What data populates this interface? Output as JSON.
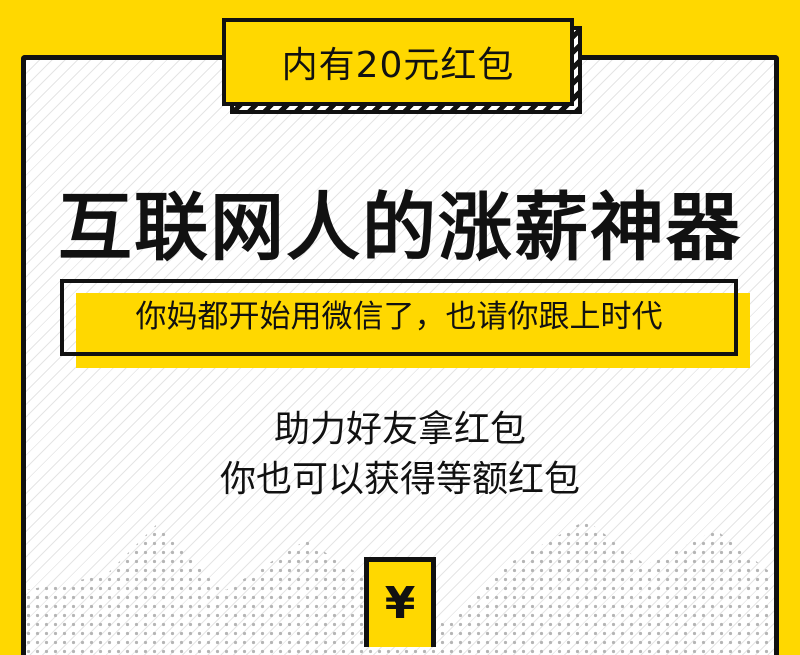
{
  "badge": {
    "text": "内有20元红包"
  },
  "title": "互联网人的涨薪神器",
  "subtitle": "你妈都开始用微信了，也请你跟上时代",
  "lines": [
    "助力好友拿红包",
    "你也可以获得等额红包"
  ],
  "yen_icon": "¥",
  "colors": {
    "background": "#ffd800",
    "card": "#ffffff",
    "ink": "#111111",
    "dots": "#b5b5b5"
  }
}
